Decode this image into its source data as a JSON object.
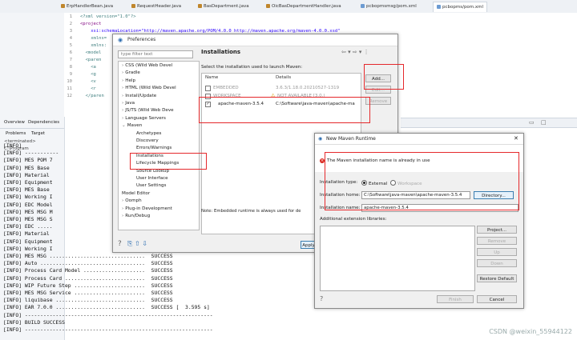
{
  "tabs": [
    {
      "label": "ErpHandlerBean.java",
      "icon": "java-file-icon"
    },
    {
      "label": "RequestHeader.java",
      "icon": "java-file-icon"
    },
    {
      "label": "BasDepartment.java",
      "icon": "java-file-icon"
    },
    {
      "label": "OicBasDepartmentHandler.java",
      "icon": "java-file-icon"
    },
    {
      "label": "pcbopmsmsg/pom.xml",
      "icon": "xml-file-icon"
    },
    {
      "label": "pcbopms/pom.xml",
      "icon": "xml-file-icon"
    }
  ],
  "editor": {
    "lines": [
      {
        "no": "1",
        "text": "<?xml version=\"1.0\"?>"
      },
      {
        "no": "2",
        "text": "<project"
      },
      {
        "no": "3",
        "text": "    xsi:schemaLocation=\"http://maven.apache.org/POM/4.0.0 http://maven.apache.org/maven-4.0.0.xsd\""
      },
      {
        "no": "4",
        "text": "    xmlns="
      },
      {
        "no": "5",
        "text": "    xmlns:"
      },
      {
        "no": "6",
        "text": "  <model"
      },
      {
        "no": "7",
        "text": "  <paren"
      },
      {
        "no": "8",
        "text": "    <a"
      },
      {
        "no": "9",
        "text": "    <g"
      },
      {
        "no": "10",
        "text": "    <v"
      },
      {
        "no": "11",
        "text": "    <r"
      },
      {
        "no": "12",
        "text": "  </paren"
      }
    ]
  },
  "views": {
    "tabs": [
      "Overview",
      "Dependencies"
    ],
    "console_tabs": [
      "Problems",
      "Target"
    ],
    "terminated": "<terminated> C:\\Program"
  },
  "console": {
    "lines": [
      "[INFO]",
      "[INFO] -----------",
      "[INFO] MES POM 7",
      "[INFO] MES Base",
      "[INFO] Material",
      "[INFO] Equipment",
      "[INFO] MES Base",
      "[INFO] Working I",
      "[INFO] EDC Model",
      "[INFO] MES MSG M",
      "[INFO] MES MSG S",
      "[INFO] EDC .....",
      "[INFO] Material",
      "[INFO] Equipment",
      "[INFO] Working I",
      "[INFO] MES MSG ...............................  SUCCESS",
      "[INFO] Auto ..................................  SUCCESS",
      "[INFO] Process Card Model ....................  SUCCESS",
      "[INFO] Process Card ..........................  SUCCESS",
      "[INFO] WIP Future Step .......................  SUCCESS",
      "[INFO] MES MSG Service .......................  SUCCESS",
      "[INFO] liquibase .............................  SUCCESS",
      "[INFO] EAR 7.0.0 .............................  SUCCESS [  3.595 s]",
      "[INFO] -------------------------------------------------------------",
      "[INFO] BUILD SUCCESS",
      "[INFO] -------------------------------------------------------------"
    ]
  },
  "preferences": {
    "title": "Preferences",
    "filter_placeholder": "type filter text",
    "tree": [
      {
        "label": "CSS (Wild Web Devel",
        "level": 0,
        "arrow": "›"
      },
      {
        "label": "Gradle",
        "level": 0,
        "arrow": "›"
      },
      {
        "label": "Help",
        "level": 0,
        "arrow": "›"
      },
      {
        "label": "HTML (Wild Web Devel",
        "level": 0,
        "arrow": "›"
      },
      {
        "label": "Install/Update",
        "level": 0,
        "arrow": "›"
      },
      {
        "label": "Java",
        "level": 0,
        "arrow": "›"
      },
      {
        "label": "JS/TS (Wild Web Deve",
        "level": 0,
        "arrow": "›"
      },
      {
        "label": "Language Servers",
        "level": 0,
        "arrow": "›"
      },
      {
        "label": "Maven",
        "level": 0,
        "arrow": "⌄"
      },
      {
        "label": "Archetypes",
        "level": 1,
        "arrow": ""
      },
      {
        "label": "Discovery",
        "level": 1,
        "arrow": ""
      },
      {
        "label": "Errors/Warnings",
        "level": 1,
        "arrow": ""
      },
      {
        "label": "Installations",
        "level": 1,
        "arrow": ""
      },
      {
        "label": "Lifecycle Mappings",
        "level": 1,
        "arrow": ""
      },
      {
        "label": "Source Lookup",
        "level": 1,
        "arrow": ""
      },
      {
        "label": "User Interface",
        "level": 1,
        "arrow": ""
      },
      {
        "label": "User Settings",
        "level": 1,
        "arrow": ""
      },
      {
        "label": "Model Editor",
        "level": 0,
        "arrow": ""
      },
      {
        "label": "Oomph",
        "level": 0,
        "arrow": "›"
      },
      {
        "label": "Plug-in Development",
        "level": 0,
        "arrow": "›"
      },
      {
        "label": "Run/Debug",
        "level": 0,
        "arrow": "›"
      }
    ],
    "heading": "Installations",
    "description": "Select the installation used to launch Maven:",
    "col_name": "Name",
    "col_details": "Details",
    "rows": [
      {
        "name": "EMBEDDED",
        "details": "3.6.3/1.18.0.20210527-1319",
        "checked": false
      },
      {
        "name": "WORKSPACE",
        "details": "NOT AVAILABLE [3.0,)",
        "checked": false
      },
      {
        "name": "apache-maven-3.5.4",
        "details": "C:\\Software\\java-maven\\apache-ma",
        "checked": true
      }
    ],
    "add_label": "Add...",
    "edit_label": "Edit...",
    "remove_label": "Remove",
    "note": "Note: Embedded runtime is always used for de",
    "apply_label": "Apply"
  },
  "maven_runtime": {
    "title": "New Maven Runtime",
    "error": "The Maven installation name is already in use",
    "install_type_label": "Installation type:",
    "type_external": "External",
    "type_workspace": "Workspace",
    "home_label": "Installation home:",
    "home_value": "C:\\Software\\java-maven\\apache-maven-3.5.4",
    "directory_label": "Directory...",
    "name_label": "Installation name:",
    "name_value": "apache-maven-3.5.4",
    "libs_label": "Additional extension libraries:",
    "project_label": "Project...",
    "remove_label": "Remove",
    "up_label": "Up",
    "down_label": "Down",
    "restore_label": "Restore Default",
    "finish_label": "Finish",
    "cancel_label": "Cancel"
  },
  "watermark": "CSDN @weixin_55944122"
}
